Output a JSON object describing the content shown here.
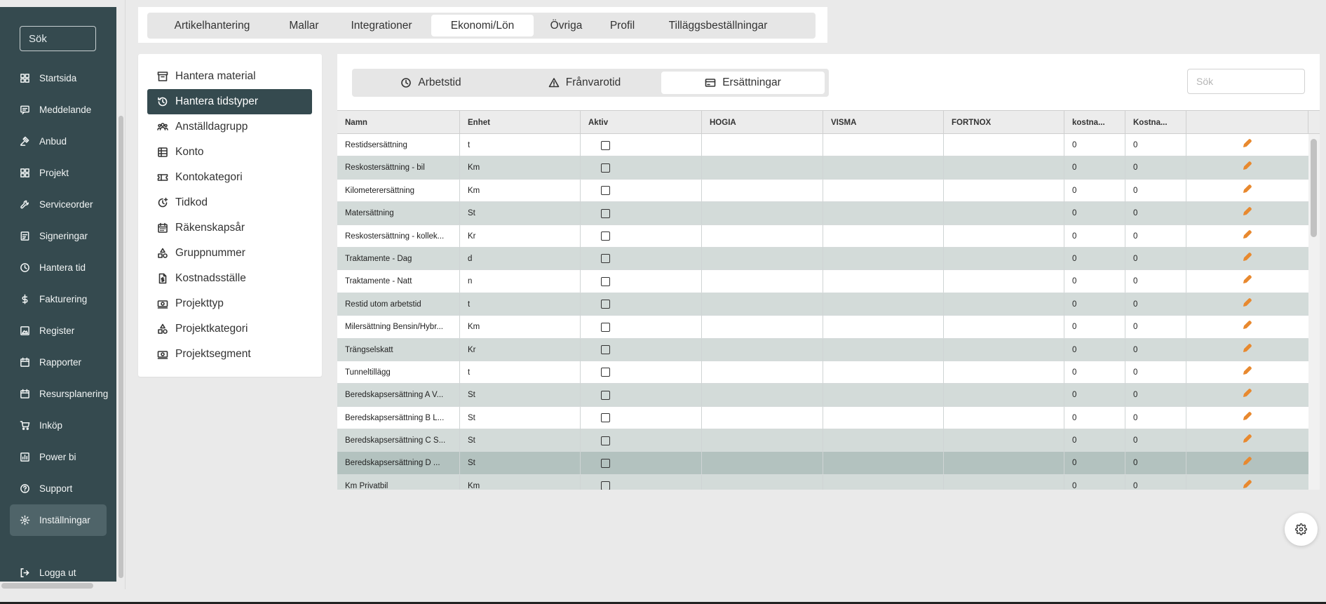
{
  "sidebar": {
    "search_placeholder": "Sök",
    "items": [
      {
        "label": "Startsida",
        "icon": "dashboard-icon"
      },
      {
        "label": "Meddelande",
        "icon": "message-icon"
      },
      {
        "label": "Anbud",
        "icon": "gavel-icon"
      },
      {
        "label": "Projekt",
        "icon": "grid-icon"
      },
      {
        "label": "Serviceorder",
        "icon": "wrench-icon"
      },
      {
        "label": "Signeringar",
        "icon": "signature-icon"
      },
      {
        "label": "Hantera tid",
        "icon": "clock-icon"
      },
      {
        "label": "Fakturering",
        "icon": "dollar-icon"
      },
      {
        "label": "Register",
        "icon": "image-icon"
      },
      {
        "label": "Rapporter",
        "icon": "calendar-icon"
      },
      {
        "label": "Resursplanering",
        "icon": "calendar-icon"
      },
      {
        "label": "Inköp",
        "icon": "cart-icon"
      },
      {
        "label": "Power bi",
        "icon": "chart-icon"
      },
      {
        "label": "Support",
        "icon": "help-icon"
      },
      {
        "label": "Inställningar",
        "icon": "gear-icon"
      }
    ],
    "active_index": 14,
    "logout_label": "Logga ut"
  },
  "top_tabs": {
    "items": [
      "Artikelhantering",
      "Mallar",
      "Integrationer",
      "Ekonomi/Lön",
      "Övriga",
      "Profil",
      "Tilläggsbeställningar"
    ],
    "active_index": 3
  },
  "left_menu": {
    "items": [
      {
        "label": "Hantera material",
        "icon": "archive-icon"
      },
      {
        "label": "Hantera tidstyper",
        "icon": "clock-history-icon"
      },
      {
        "label": "Anställdagrupp",
        "icon": "people-icon"
      },
      {
        "label": "Konto",
        "icon": "table-icon"
      },
      {
        "label": "Kontokategori",
        "icon": "ticket-icon"
      },
      {
        "label": "Tidkod",
        "icon": "clock-plus-icon"
      },
      {
        "label": "Räkenskapsår",
        "icon": "calendar-grid-icon"
      },
      {
        "label": "Gruppnummer",
        "icon": "shapes-icon"
      },
      {
        "label": "Kostnadsställe",
        "icon": "document-dollar-icon"
      },
      {
        "label": "Projekttyp",
        "icon": "money-icon"
      },
      {
        "label": "Projektkategori",
        "icon": "shapes-icon"
      },
      {
        "label": "Projektsegment",
        "icon": "money-icon"
      }
    ],
    "active_index": 1
  },
  "sub_tabs": {
    "items": [
      {
        "label": "Arbetstid",
        "icon": "clock-icon"
      },
      {
        "label": "Frånvarotid",
        "icon": "warning-icon"
      },
      {
        "label": "Ersättningar",
        "icon": "credit-card-icon"
      }
    ],
    "active_index": 2
  },
  "main_search_placeholder": "Sök",
  "table": {
    "columns": [
      "Namn",
      "Enhet",
      "Aktiv",
      "HOGIA",
      "VISMA",
      "FORTNOX",
      "kostna...",
      "Kostna...",
      ""
    ],
    "rows": [
      {
        "name": "Restidsersättning",
        "unit": "t",
        "active": false,
        "hogia": "",
        "visma": "",
        "fortnox": "",
        "k1": "0",
        "k2": "0"
      },
      {
        "name": "Reskostersättning - bil",
        "unit": "Km",
        "active": false,
        "hogia": "",
        "visma": "",
        "fortnox": "",
        "k1": "0",
        "k2": "0"
      },
      {
        "name": "Kilometerersättning",
        "unit": "Km",
        "active": false,
        "hogia": "",
        "visma": "",
        "fortnox": "",
        "k1": "0",
        "k2": "0"
      },
      {
        "name": "Matersättning",
        "unit": "St",
        "active": false,
        "hogia": "",
        "visma": "",
        "fortnox": "",
        "k1": "0",
        "k2": "0"
      },
      {
        "name": "Reskostersättning - kollek...",
        "unit": "Kr",
        "active": false,
        "hogia": "",
        "visma": "",
        "fortnox": "",
        "k1": "0",
        "k2": "0"
      },
      {
        "name": "Traktamente - Dag",
        "unit": "d",
        "active": false,
        "hogia": "",
        "visma": "",
        "fortnox": "",
        "k1": "0",
        "k2": "0"
      },
      {
        "name": "Traktamente - Natt",
        "unit": "n",
        "active": false,
        "hogia": "",
        "visma": "",
        "fortnox": "",
        "k1": "0",
        "k2": "0"
      },
      {
        "name": "Restid utom arbetstid",
        "unit": "t",
        "active": false,
        "hogia": "",
        "visma": "",
        "fortnox": "",
        "k1": "0",
        "k2": "0"
      },
      {
        "name": "Milersättning Bensin/Hybr...",
        "unit": "Km",
        "active": false,
        "hogia": "",
        "visma": "",
        "fortnox": "",
        "k1": "0",
        "k2": "0"
      },
      {
        "name": "Trängselskatt",
        "unit": "Kr",
        "active": false,
        "hogia": "",
        "visma": "",
        "fortnox": "",
        "k1": "0",
        "k2": "0"
      },
      {
        "name": "Tunneltillägg",
        "unit": "t",
        "active": false,
        "hogia": "",
        "visma": "",
        "fortnox": "",
        "k1": "0",
        "k2": "0"
      },
      {
        "name": "Beredskapsersättning A V...",
        "unit": "St",
        "active": false,
        "hogia": "",
        "visma": "",
        "fortnox": "",
        "k1": "0",
        "k2": "0"
      },
      {
        "name": "Beredskapsersättning B L...",
        "unit": "St",
        "active": false,
        "hogia": "",
        "visma": "",
        "fortnox": "",
        "k1": "0",
        "k2": "0"
      },
      {
        "name": "Beredskapsersättning C S...",
        "unit": "St",
        "active": false,
        "hogia": "",
        "visma": "",
        "fortnox": "",
        "k1": "0",
        "k2": "0"
      },
      {
        "name": "Beredskapsersättning D ...",
        "unit": "St",
        "active": false,
        "hogia": "",
        "visma": "",
        "fortnox": "",
        "k1": "0",
        "k2": "0"
      },
      {
        "name": "Km Privatbil",
        "unit": "Km",
        "active": false,
        "hogia": "",
        "visma": "",
        "fortnox": "",
        "k1": "0",
        "k2": "0"
      }
    ],
    "selected_row_index": 14
  },
  "colors": {
    "sidebar_bg": "#354a4f",
    "sidebar_active": "#4f6469",
    "row_alt": "#d3dbd9",
    "row_selected": "#b3c2bf",
    "edit_icon": "#e8892f"
  }
}
